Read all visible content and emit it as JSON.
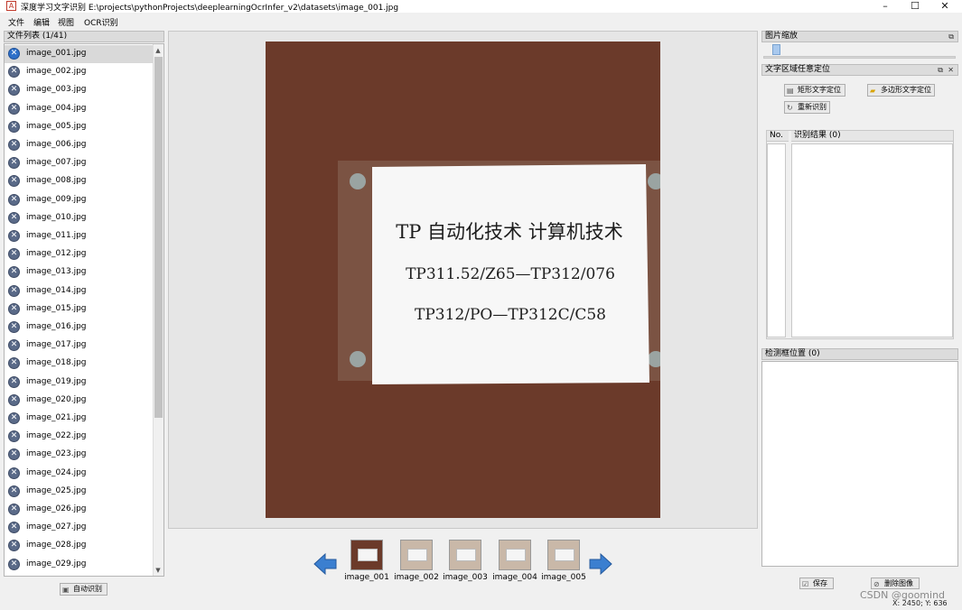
{
  "window": {
    "title": "深度学习文字识别 E:\\projects\\pythonProjects\\deeplearningOcrInfer_v2\\datasets\\image_001.jpg",
    "app_icon": "A",
    "controls": [
      "–",
      "☐",
      "✕"
    ]
  },
  "menu": [
    "文件",
    "编辑",
    "视图",
    "OCR识别"
  ],
  "file_panel": {
    "title": "文件列表 (1/41)",
    "files": [
      "image_001.jpg",
      "image_002.jpg",
      "image_003.jpg",
      "image_004.jpg",
      "image_005.jpg",
      "image_006.jpg",
      "image_007.jpg",
      "image_008.jpg",
      "image_009.jpg",
      "image_010.jpg",
      "image_011.jpg",
      "image_012.jpg",
      "image_013.jpg",
      "image_014.jpg",
      "image_015.jpg",
      "image_016.jpg",
      "image_017.jpg",
      "image_018.jpg",
      "image_019.jpg",
      "image_020.jpg",
      "image_021.jpg",
      "image_022.jpg",
      "image_023.jpg",
      "image_024.jpg",
      "image_025.jpg",
      "image_026.jpg",
      "image_027.jpg",
      "image_028.jpg",
      "image_029.jpg"
    ],
    "selected_index": 0,
    "auto_button": "自动识别",
    "file_icon": "close-circle-icon"
  },
  "photo": {
    "line1": "TP 自动化技术  计算机技术",
    "line2": "TP311.52/Z65—TP312/076",
    "line3": "TP312/PO—TP312C/C58",
    "wall_color": "#6b3a2a",
    "paper_color": "#f7f7f7"
  },
  "thumbnails": [
    "image_001",
    "image_002",
    "image_003",
    "image_004",
    "image_005"
  ],
  "zoom_panel": {
    "title": "图片缩放",
    "level": 0.07
  },
  "region_panel": {
    "title": "文字区域任意定位",
    "rect_button": "矩形文字定位",
    "poly_button": "多边形文字定位",
    "redo_button": "重新识别",
    "col_no": "No.",
    "col_result": "识别结果 (0)"
  },
  "bbox_panel": {
    "title": "检测框位置 (0)"
  },
  "bottom": {
    "save_button": "保存",
    "delete_button": "删除图像",
    "coords": "X: 2450; Y: 636",
    "watermark": "CSDN @goomind"
  }
}
